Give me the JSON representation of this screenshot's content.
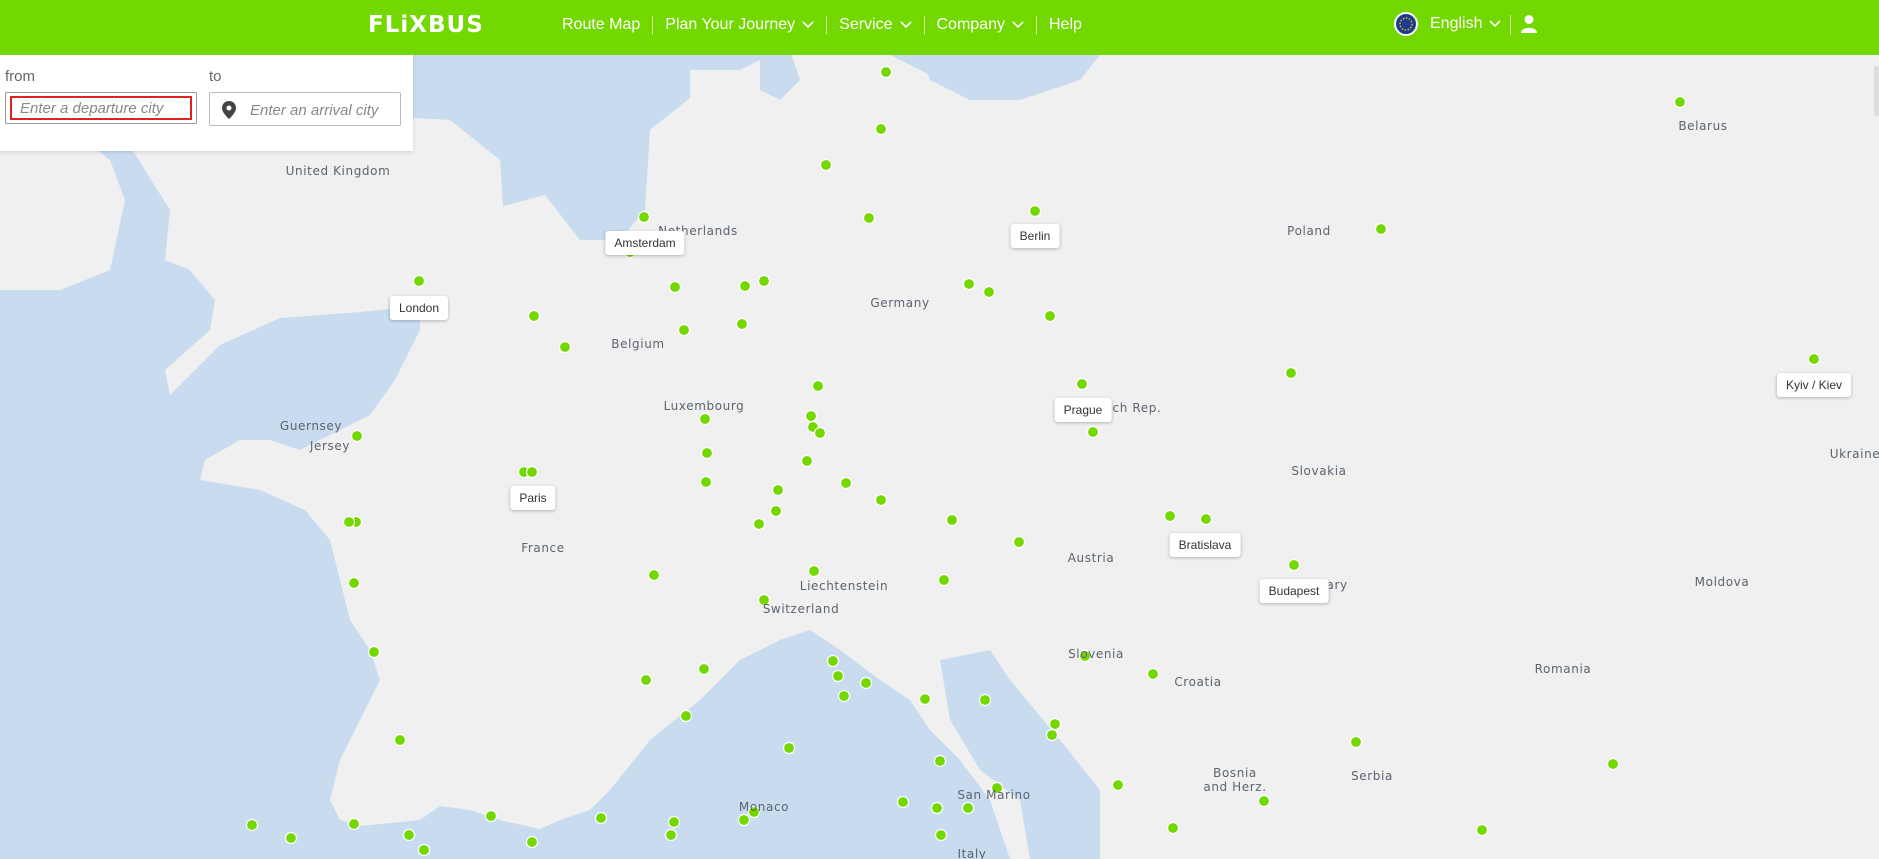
{
  "header": {
    "logo": "FLiXBUS",
    "nav": [
      {
        "label": "Route Map",
        "dropdown": false
      },
      {
        "label": "Plan Your Journey",
        "dropdown": true
      },
      {
        "label": "Service",
        "dropdown": true
      },
      {
        "label": "Company",
        "dropdown": true
      },
      {
        "label": "Help",
        "dropdown": false
      }
    ],
    "language": "English",
    "language_icon": "eu-flag-icon",
    "account_icon": "user-icon",
    "brand_color": "#73d700"
  },
  "search": {
    "from_label": "from",
    "from_placeholder": "Enter a departure city",
    "to_label": "to",
    "to_placeholder": "Enter an arrival city"
  },
  "map": {
    "land_color": "#f0f0f1",
    "water_color": "#c9dcef",
    "stop_color": "#73d700",
    "regions": [
      "United Kingdom",
      "Guernsey",
      "Jersey",
      "France",
      "Belgium",
      "Luxembourg",
      "Germany",
      "Poland",
      "Belarus",
      "Ukraine",
      "Liechtenstein",
      "Switzerland",
      "Austria",
      "Slovakia",
      "Moldova",
      "Croatia",
      "Romania",
      "Bosnia",
      "and Herz.",
      "Serbia",
      "San Marino",
      "Monaco",
      "Slovenia",
      "Czech Rep.",
      "Hungary",
      "Netherlands",
      "Italy"
    ],
    "city_labels": [
      "London",
      "Amsterdam",
      "Berlin",
      "Paris",
      "Prague",
      "Bratislava",
      "Budapest",
      "Kyiv / Kiev"
    ]
  }
}
